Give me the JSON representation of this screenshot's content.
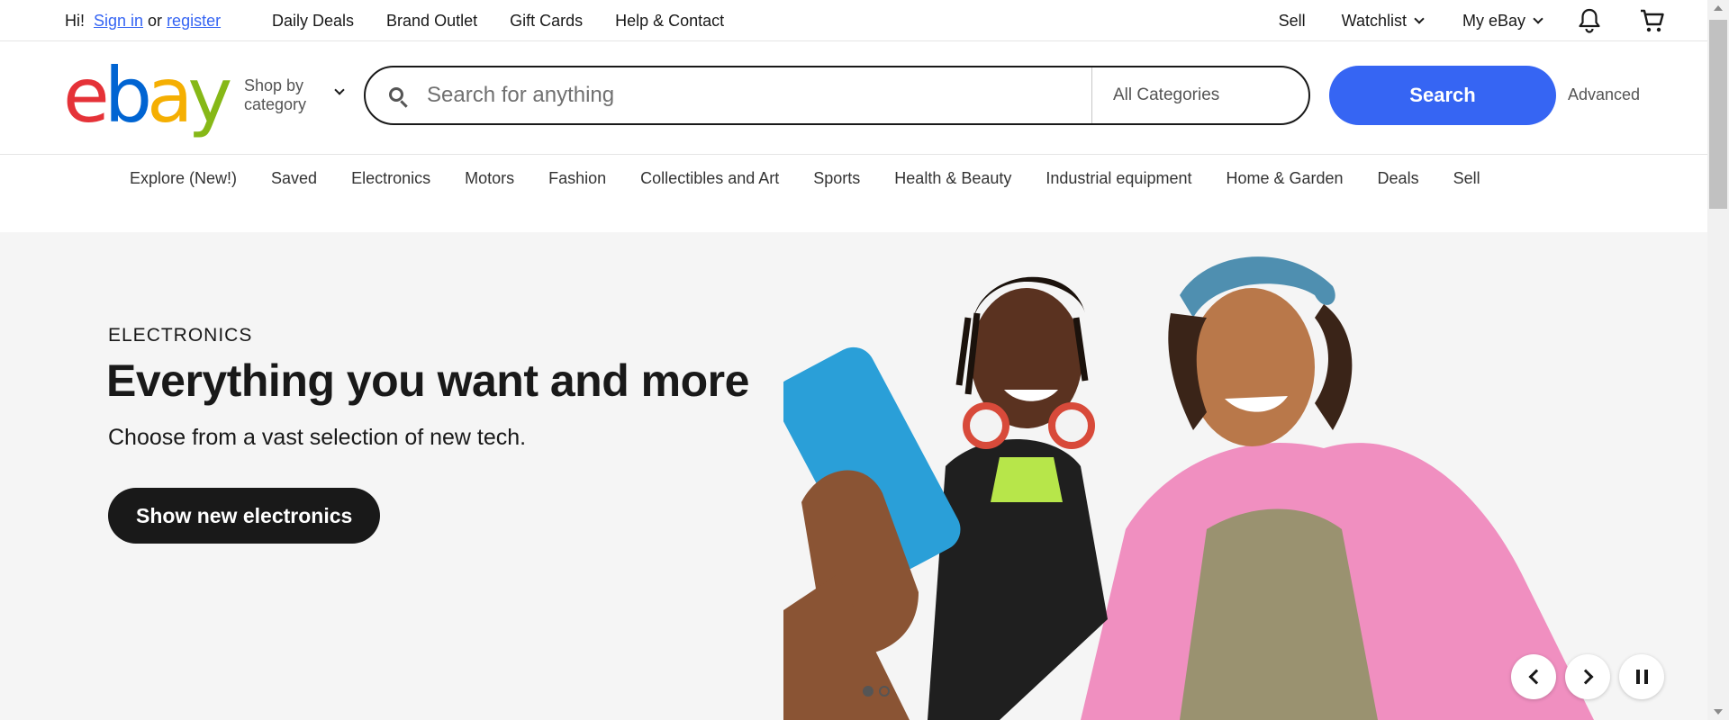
{
  "topbar": {
    "greeting": "Hi!",
    "sign_in": "Sign in",
    "or": "or",
    "register": "register",
    "links": [
      "Daily Deals",
      "Brand Outlet",
      "Gift Cards",
      "Help & Contact"
    ],
    "sell": "Sell",
    "watchlist": "Watchlist",
    "my_ebay": "My eBay",
    "icons": {
      "notifications": "bell-icon",
      "cart": "cart-icon"
    }
  },
  "header": {
    "logo": {
      "e": "e",
      "b": "b",
      "a": "a",
      "y": "y"
    },
    "shop_by_line1": "Shop by",
    "shop_by_line2": "category",
    "search_placeholder": "Search for anything",
    "category_select": "All Categories",
    "search_button": "Search",
    "advanced": "Advanced"
  },
  "categories": [
    "Explore (New!)",
    "Saved",
    "Electronics",
    "Motors",
    "Fashion",
    "Collectibles and Art",
    "Sports",
    "Health & Beauty",
    "Industrial equipment",
    "Home & Garden",
    "Deals",
    "Sell"
  ],
  "hero": {
    "eyebrow": "ELECTRONICS",
    "headline": "Everything you want and more",
    "subtext": "Choose from a vast selection of new tech.",
    "cta": "Show new electronics"
  },
  "colors": {
    "accent": "#3665f3",
    "logo_red": "#e53238",
    "logo_blue": "#0064d2",
    "logo_yellow": "#f5af02",
    "logo_green": "#86b817"
  }
}
